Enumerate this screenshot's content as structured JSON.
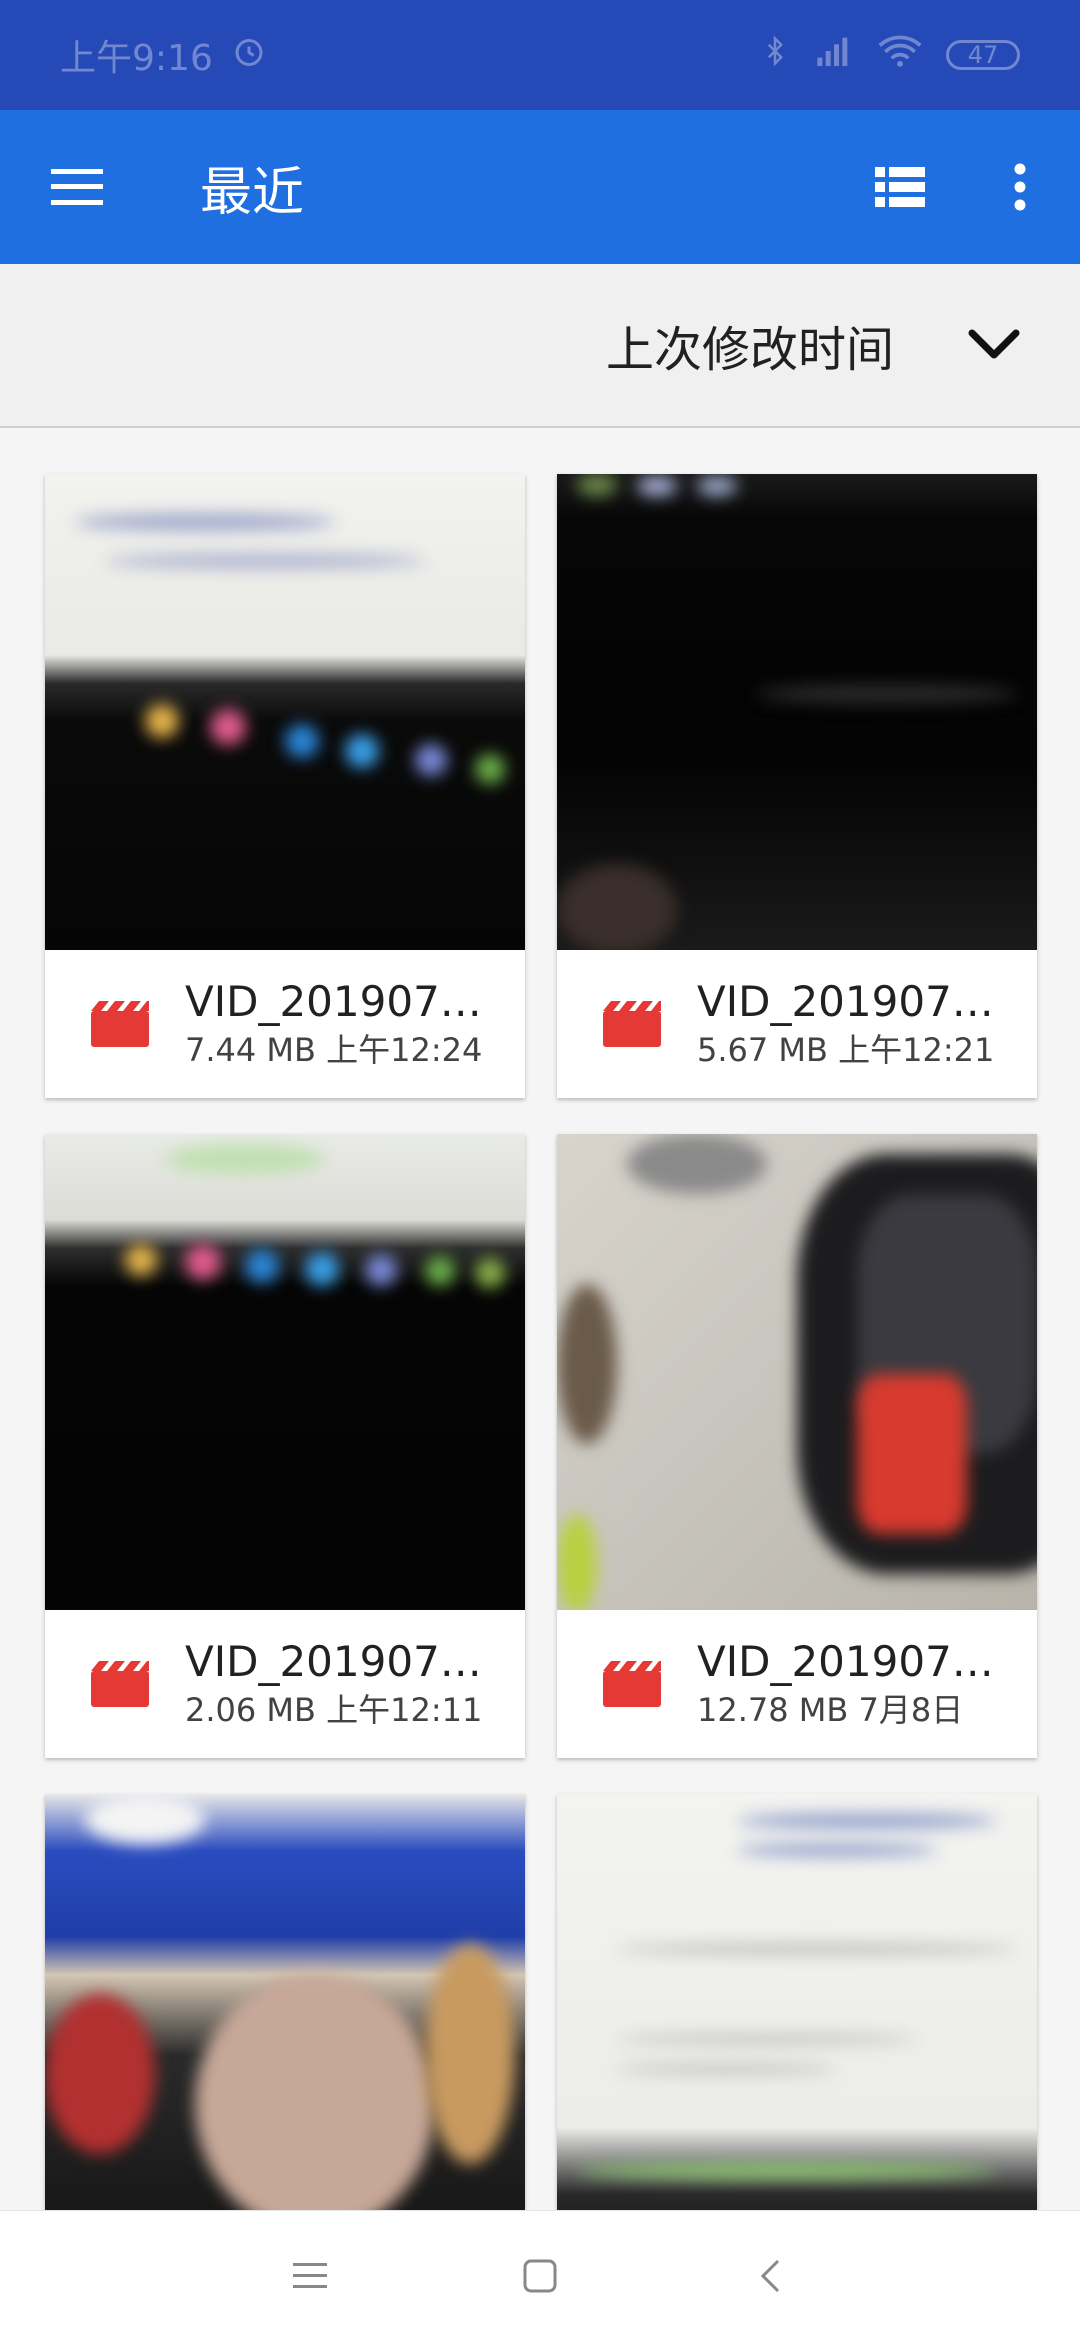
{
  "status_bar": {
    "time": "上午9:16",
    "battery": "47"
  },
  "app_bar": {
    "title": "最近"
  },
  "sort_bar": {
    "label": "上次修改时间"
  },
  "files": [
    {
      "name": "VID_2019070…",
      "meta": "7.44 MB  上午12:24"
    },
    {
      "name": "VID_2019070…",
      "meta": "5.67 MB  上午12:21"
    },
    {
      "name": "VID_2019070…",
      "meta": "2.06 MB  上午12:11"
    },
    {
      "name": "VID_2019070…",
      "meta": "12.78 MB  7月8日"
    }
  ],
  "colors": {
    "status_bar": "#2649b8",
    "app_bar": "#1f6fe0",
    "video_icon": "#e53935"
  }
}
